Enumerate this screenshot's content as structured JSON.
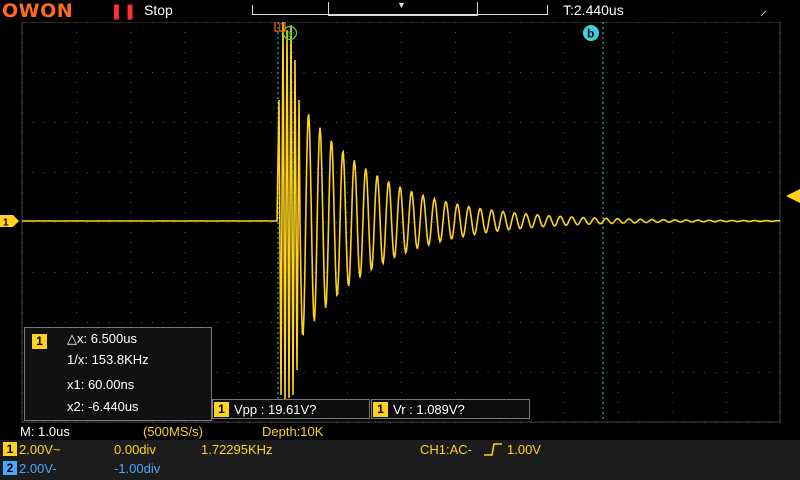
{
  "topbar": {
    "logo": "OWON",
    "run_icon": "pause-icon",
    "run_state": "Stop",
    "trigger_time": "T:2.440us",
    "usb_icon": "usb-icon"
  },
  "colors": {
    "ch1": "#ffd21e",
    "ch2": "#46a8ff",
    "cursor_b": "#3fd0e0",
    "logo": "#ff6a1e",
    "grid": "#5a5a5a"
  },
  "cursors": {
    "b_label": "b"
  },
  "measure_panel": {
    "channel": "1",
    "dx": "△x: 6.500us",
    "inv_dx": "1/x:  153.8KHz",
    "x1": "x1: 60.00ns",
    "x2": "x2: -6.440us"
  },
  "measurements": [
    {
      "channel": "1",
      "text": "Vpp : 19.61V?"
    },
    {
      "channel": "1",
      "text": "Vr : 1.089V?"
    }
  ],
  "status": {
    "timebase": "M: 1.0us",
    "sample_rate": "(500MS/s)",
    "depth": "Depth:10K",
    "ch1_label": "1",
    "ch1_scale": "2.00V~",
    "ch1_offset": "0.00div",
    "frequency": "1.72295KHz",
    "trigger": "CH1:AC-",
    "trigger_level": "1.00V",
    "ch2_label": "2",
    "ch2_scale": "2.00V-",
    "ch2_offset": "-1.00div"
  }
}
